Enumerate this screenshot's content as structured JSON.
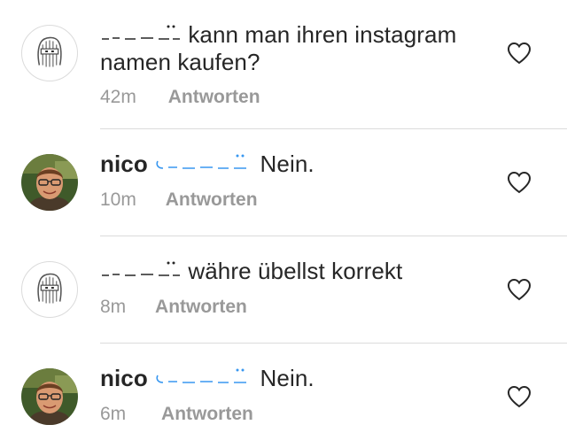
{
  "comments": [
    {
      "avatar": "ghost-avatar",
      "mention_redacted": true,
      "text": "kann man ihren instagram namen kaufen?",
      "time": "42m",
      "reply_label": "Antworten"
    },
    {
      "avatar": "photo-avatar",
      "username": "nico",
      "mention_redacted": true,
      "text": "Nein.",
      "time": "10m",
      "reply_label": "Antworten"
    },
    {
      "avatar": "ghost-avatar",
      "mention_redacted": true,
      "text": "währe übellst korrekt",
      "time": "8m",
      "reply_label": "Antworten"
    },
    {
      "avatar": "photo-avatar",
      "username": "nico",
      "mention_redacted": true,
      "text": "Nein.",
      "time": "6m",
      "reply_label": "Antworten"
    }
  ],
  "icons": {
    "like": "heart-outline-icon"
  },
  "colors": {
    "text": "#262626",
    "secondary": "#999999",
    "divider": "#dbdbdb",
    "mention_blue": "#3897f0"
  }
}
